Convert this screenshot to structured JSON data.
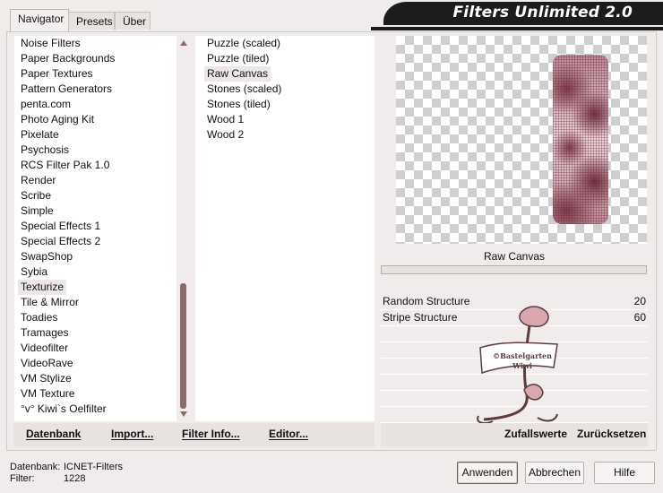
{
  "tabs": [
    {
      "label": "Navigator",
      "active": true
    },
    {
      "label": "Presets",
      "active": false
    },
    {
      "label": "Über",
      "active": false
    }
  ],
  "banner": {
    "title": "Filters Unlimited 2.0"
  },
  "categories": {
    "items": [
      "Noise Filters",
      "Paper Backgrounds",
      "Paper Textures",
      "Pattern Generators",
      "penta.com",
      "Photo Aging Kit",
      "Pixelate",
      "Psychosis",
      "RCS Filter Pak 1.0",
      "Render",
      "Scribe",
      "Simple",
      "Special Effects 1",
      "Special Effects 2",
      "SwapShop",
      "Sybia",
      "Texturize",
      "Tile & Mirror",
      "Toadies",
      "Tramages",
      "Videofilter",
      "VideoRave",
      "VM Stylize",
      "VM Texture",
      "°v° Kiwi`s Oelfilter"
    ],
    "selected": "Texturize"
  },
  "filters": {
    "items": [
      "Puzzle (scaled)",
      "Puzzle (tiled)",
      "Raw Canvas",
      "Stones (scaled)",
      "Stones (tiled)",
      "Wood 1",
      "Wood 2"
    ],
    "selected": "Raw Canvas"
  },
  "preview": {
    "filter_name": "Raw Canvas"
  },
  "params": [
    {
      "name": "Random Structure",
      "value": "20"
    },
    {
      "name": "Stripe Structure",
      "value": "60"
    }
  ],
  "watermark": {
    "text": "©Bastelgarten Wiwi"
  },
  "left_toolbar": {
    "datenbank": "Datenbank",
    "import": "Import...",
    "filter_info": "Filter Info...",
    "editor": "Editor..."
  },
  "right_toolbar": {
    "random": "Zufallswerte",
    "reset": "Zurücksetzen"
  },
  "status": {
    "db_label": "Datenbank:",
    "db_value": "ICNET-Filters",
    "filter_label": "Filter:",
    "filter_value": "1228"
  },
  "buttons": {
    "apply": "Anwenden",
    "cancel": "Abbrechen",
    "help": "Hilfe"
  },
  "colors": {
    "accent": "#8c6b6f",
    "banner_bg": "#1c1c1c",
    "bg": "#f0eceb"
  }
}
